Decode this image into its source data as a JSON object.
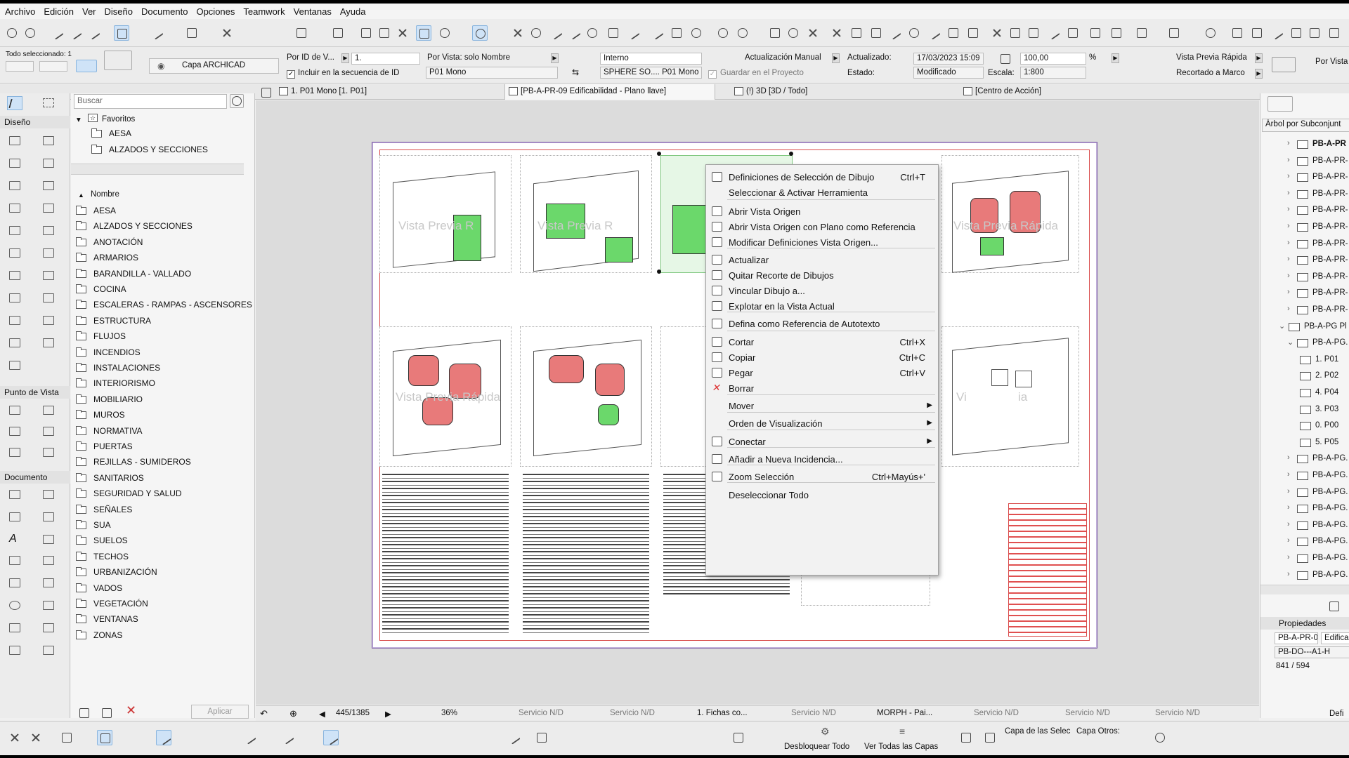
{
  "menu": [
    "Archivo",
    "Edición",
    "Ver",
    "Diseño",
    "Documento",
    "Opciones",
    "Teamwork",
    "Ventanas",
    "Ayuda"
  ],
  "info": {
    "selection_status": "Todo seleccionado: 1",
    "layer_label": "Capa ARCHICAD",
    "by_id": "Por ID de V...",
    "id_value": "1.",
    "include_in_id": "Incluir en la secuencia de ID",
    "by_view": "Por Vista: solo Nombre",
    "view_name": "P01 Mono",
    "internal": "Interno",
    "source_path": "SPHERE SO.... P01 Mono",
    "save_in_project": "Guardar en el Proyecto",
    "update_mode": "Actualización Manual",
    "updated_label": "Actualizado:",
    "updated_value": "17/03/2023 15:09",
    "state_label": "Estado:",
    "state_value": "Modificado",
    "scale_pct": "100,00",
    "pct_sign": "%",
    "scale_label": "Escala:",
    "scale_value": "1:800",
    "quick_preview": "Vista Previa Rápida",
    "crop_frame": "Recortado a Marco",
    "by_view_right": "Por Vista"
  },
  "tabs": [
    "1. P01 Mono [1. P01]",
    "[PB-A-PR-09 Edificabilidad - Plano llave]",
    "(!) 3D [3D / Todo]",
    "[Centro de Acción]"
  ],
  "toolbox": {
    "sections": [
      "Diseño",
      "Punto de Vista",
      "Documento"
    ]
  },
  "navigator": {
    "search_placeholder": "Buscar",
    "favorites_label": "Favoritos",
    "favorites": [
      "AESA",
      "ALZADOS Y SECCIONES"
    ],
    "name_header": "Nombre",
    "folders": [
      "AESA",
      "ALZADOS Y SECCIONES",
      "ANOTACIÓN",
      "ARMARIOS",
      "BARANDILLA - VALLADO",
      "COCINA",
      "ESCALERAS - RAMPAS - ASCENSORES",
      "ESTRUCTURA",
      "FLUJOS",
      "INCENDIOS",
      "INSTALACIONES",
      "INTERIORISMO",
      "MOBILIARIO",
      "MUROS",
      "NORMATIVA",
      "PUERTAS",
      "REJILLAS - SUMIDEROS",
      "SANITARIOS",
      "SEGURIDAD Y SALUD",
      "SEÑALES",
      "SUA",
      "SUELOS",
      "TECHOS",
      "URBANIZACIÓN",
      "VADOS",
      "VEGETACIÓN",
      "VENTANAS",
      "ZONAS"
    ],
    "apply_label": "Aplicar"
  },
  "drawing": {
    "watermark_a": "Vista Previa R",
    "watermark_b": "Vista Previa R",
    "watermark_c": "Vista Previa Rápida",
    "watermark_d": "Vista Previa Rápida",
    "watermark_e": "Vi",
    "watermark_f": "ia"
  },
  "context_menu": [
    {
      "label": "Definiciones de Selección de Dibujo",
      "shortcut": "Ctrl+T"
    },
    {
      "label": "Seleccionar & Activar Herramienta",
      "shortcut": ""
    },
    {
      "label": "Abrir Vista Origen",
      "shortcut": ""
    },
    {
      "label": "Abrir Vista Origen con Plano como Referencia",
      "shortcut": ""
    },
    {
      "label": "Modificar Definiciones Vista Origen...",
      "shortcut": ""
    },
    {
      "label": "Actualizar",
      "shortcut": ""
    },
    {
      "label": "Quitar Recorte de Dibujos",
      "shortcut": ""
    },
    {
      "label": "Vincular Dibujo a...",
      "shortcut": ""
    },
    {
      "label": "Explotar en la Vista Actual",
      "shortcut": ""
    },
    {
      "label": "Defina como Referencia de Autotexto",
      "shortcut": ""
    },
    {
      "label": "Cortar",
      "shortcut": "Ctrl+X"
    },
    {
      "label": "Copiar",
      "shortcut": "Ctrl+C"
    },
    {
      "label": "Pegar",
      "shortcut": "Ctrl+V"
    },
    {
      "label": "Borrar",
      "shortcut": ""
    },
    {
      "label": "Mover",
      "shortcut": ""
    },
    {
      "label": "Orden de Visualización",
      "shortcut": ""
    },
    {
      "label": "Conectar",
      "shortcut": ""
    },
    {
      "label": "Añadir a Nueva Incidencia...",
      "shortcut": ""
    },
    {
      "label": "Zoom Selección",
      "shortcut": "Ctrl+Mayús+'"
    },
    {
      "label": "Deseleccionar Todo",
      "shortcut": ""
    }
  ],
  "right_panel": {
    "tree_header": "Árbol por Subconjunt",
    "items": [
      "PB-A-PR",
      "PB-A-PR-",
      "PB-A-PR-",
      "PB-A-PR-",
      "PB-A-PR-",
      "PB-A-PR-",
      "PB-A-PR-",
      "PB-A-PR-",
      "PB-A-PR-",
      "PB-A-PR-",
      "PB-A-PR-"
    ],
    "group": "PB-A-PG Pl",
    "group_item": "PB-A-PG.",
    "levels": [
      "1. P01",
      "2. P02",
      "4. P04",
      "3. P03",
      "0. P00",
      "5. P05"
    ],
    "tail_items": [
      "PB-A-PG.",
      "PB-A-PG.",
      "PB-A-PG.",
      "PB-A-PG.",
      "PB-A-PG.",
      "PB-A-PG.",
      "PB-A-PG.",
      "PB-A-PG."
    ],
    "props_header": "Propiedades",
    "prop_id": "PB-A-PR-0",
    "prop_name": "Edifica",
    "prop_code": "PB-DO---A1-H",
    "prop_size": "841 / 594",
    "prop_def": "Defi"
  },
  "statusbar": {
    "page": "445/1385",
    "zoom": "36%",
    "n1": "Servicio N/D",
    "n2": "Servicio N/D",
    "fichas": "1. Fichas co...",
    "n3": "Servicio N/D",
    "morph": "MORPH - Pai...",
    "n4": "Servicio N/D",
    "n5": "Servicio N/D",
    "n6": "Servicio N/D"
  },
  "bottombar": {
    "unlock_all": "Desbloquear Todo",
    "show_layers": "Ver Todas las Capas",
    "layer_sel": "Capa de las Selec",
    "layer_other": "Capa Otros:"
  }
}
